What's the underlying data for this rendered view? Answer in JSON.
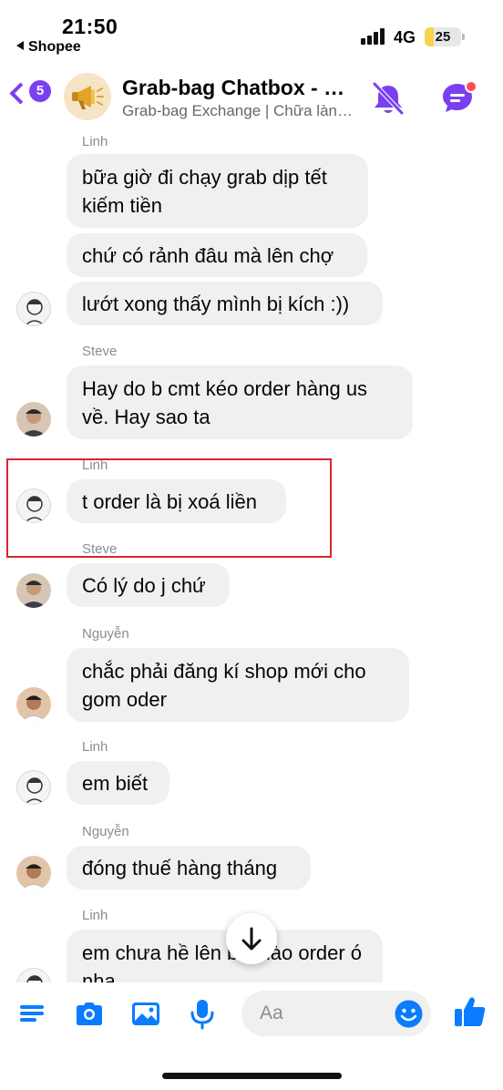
{
  "status_bar": {
    "time": "21:50",
    "back_app": "Shopee",
    "network": "4G",
    "battery": "25",
    "battery_level": 0.25
  },
  "header": {
    "back_count": "5",
    "title": "Grab-bag Chatbox - Cộng đồng Grab-bag",
    "subtitle": "Grab-bag Exchange | Chữa lành cộng đồng",
    "icons": [
      "back-chevron-icon",
      "megaphone-icon",
      "muted-bell-icon",
      "chat-threads-icon"
    ]
  },
  "messages": [
    {
      "sender": "Linh",
      "texts": [
        "bữa giờ đi chạy grab dịp tết kiếm tiền",
        "chứ có rảnh đâu mà lên chợ",
        "lướt xong thấy mình bị kích :))"
      ]
    },
    {
      "sender": "Steve",
      "texts": [
        "Hay do b cmt kéo order hàng us về. Hay sao ta"
      ]
    },
    {
      "sender": "Linh",
      "texts": [
        "t order là bị xoá liền"
      ]
    },
    {
      "sender": "Steve",
      "texts": [
        "Có lý do j chứ"
      ]
    },
    {
      "sender": "Nguyễn",
      "texts": [
        "chắc phải đăng kí shop mới cho gom oder"
      ]
    },
    {
      "sender": "Linh",
      "texts": [
        "em biết"
      ]
    },
    {
      "sender": "Nguyễn",
      "texts": [
        "đóng thuế hàng tháng"
      ]
    },
    {
      "sender": "Linh",
      "texts": [
        "em chưa hề lên bài nào order ó nha"
      ]
    }
  ],
  "composer": {
    "placeholder": "Aa",
    "icons": [
      "menu-icon",
      "camera-icon",
      "image-icon",
      "microphone-icon",
      "emoji-icon",
      "thumbs-up-icon"
    ]
  },
  "colors": {
    "accent": "#7b3ff2",
    "composer_blue": "#0a7cff",
    "bubble_bg": "#f0f0f0",
    "highlight_box": "#d6272e"
  }
}
